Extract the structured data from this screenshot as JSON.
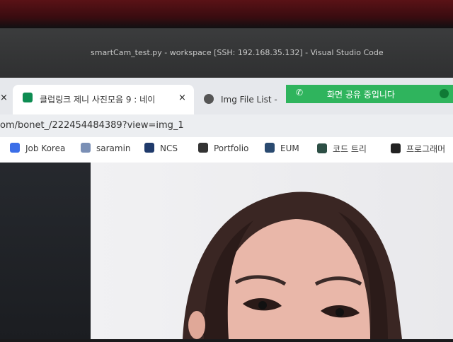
{
  "window_title": "smartCam_test.py - workspace [SSH: 192.168.35.132] - Visual Studio Code",
  "tabs": [
    {
      "title": "클럽링크 제니 사진모음 9 : 네이",
      "close": "×",
      "icon": "naver-blog-icon"
    },
    {
      "title": "Img File List - ",
      "icon": "globe-icon"
    }
  ],
  "screen_share": {
    "text": "화면 공유 중입니다",
    "icon": "phone-icon",
    "status_icon": "check-icon"
  },
  "url": "om/bonet_/222454484389?view=img_1",
  "bookmarks": [
    {
      "label": "Job Korea",
      "icon": "jobkorea-icon"
    },
    {
      "label": "saramin",
      "icon": "saramin-icon"
    },
    {
      "label": "NCS",
      "icon": "ncs-icon"
    },
    {
      "label": "Portfolio",
      "icon": "notion-icon"
    },
    {
      "label": "EUM",
      "icon": "eum-icon"
    },
    {
      "label": "코드 트리",
      "icon": "codetree-icon"
    },
    {
      "label": "프로그래머",
      "icon": "programmers-icon"
    }
  ],
  "colors": {
    "share_bar": "#2fb45d",
    "tab_bg": "#ffffff",
    "tabstrip": "#e6e8ec",
    "vscode_title": "#2f3031"
  }
}
